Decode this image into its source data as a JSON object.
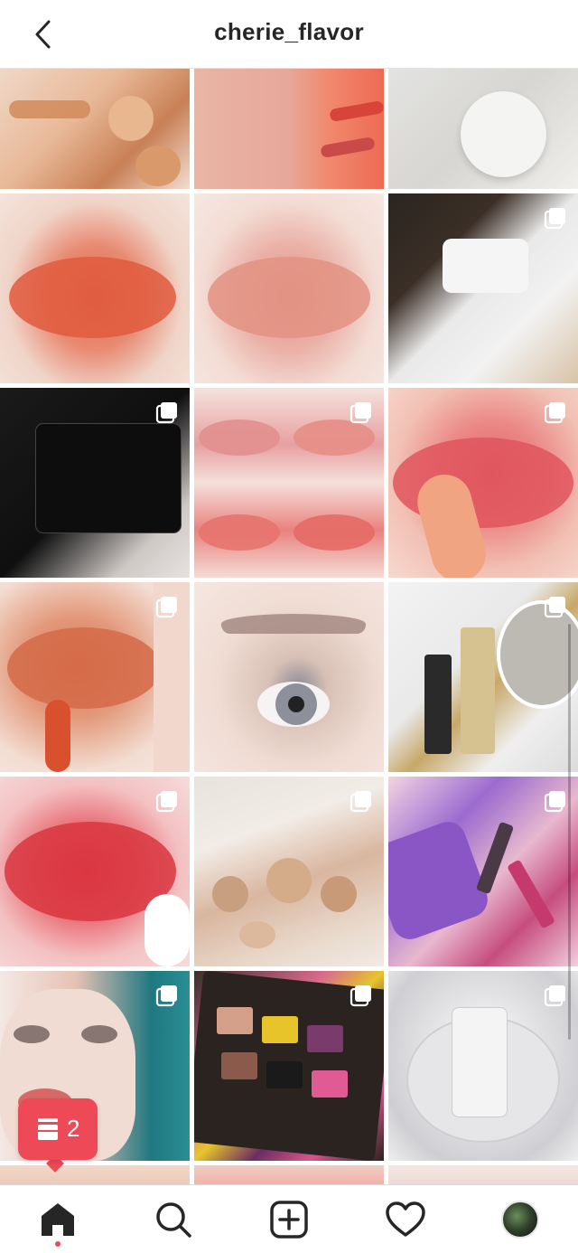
{
  "header": {
    "title": "cherie_flavor"
  },
  "grid": {
    "tiles": [
      {
        "multi": false
      },
      {
        "multi": false
      },
      {
        "multi": false
      },
      {
        "multi": false
      },
      {
        "multi": false
      },
      {
        "multi": true
      },
      {
        "multi": true
      },
      {
        "multi": true
      },
      {
        "multi": true
      },
      {
        "multi": true
      },
      {
        "multi": false
      },
      {
        "multi": true
      },
      {
        "multi": true
      },
      {
        "multi": true
      },
      {
        "multi": true
      },
      {
        "multi": true
      },
      {
        "multi": true
      },
      {
        "multi": true
      },
      {
        "multi": false
      },
      {
        "multi": false
      },
      {
        "multi": false
      }
    ]
  },
  "badge": {
    "count": "2"
  },
  "bottom_nav": {
    "items": [
      {
        "icon": "home-icon",
        "active": true
      },
      {
        "icon": "search-icon"
      },
      {
        "icon": "add-post-icon"
      },
      {
        "icon": "heart-icon"
      },
      {
        "icon": "profile-avatar"
      }
    ]
  },
  "colors": {
    "accent": "#ed4956",
    "text": "#262626",
    "border": "#dbdbdb"
  }
}
